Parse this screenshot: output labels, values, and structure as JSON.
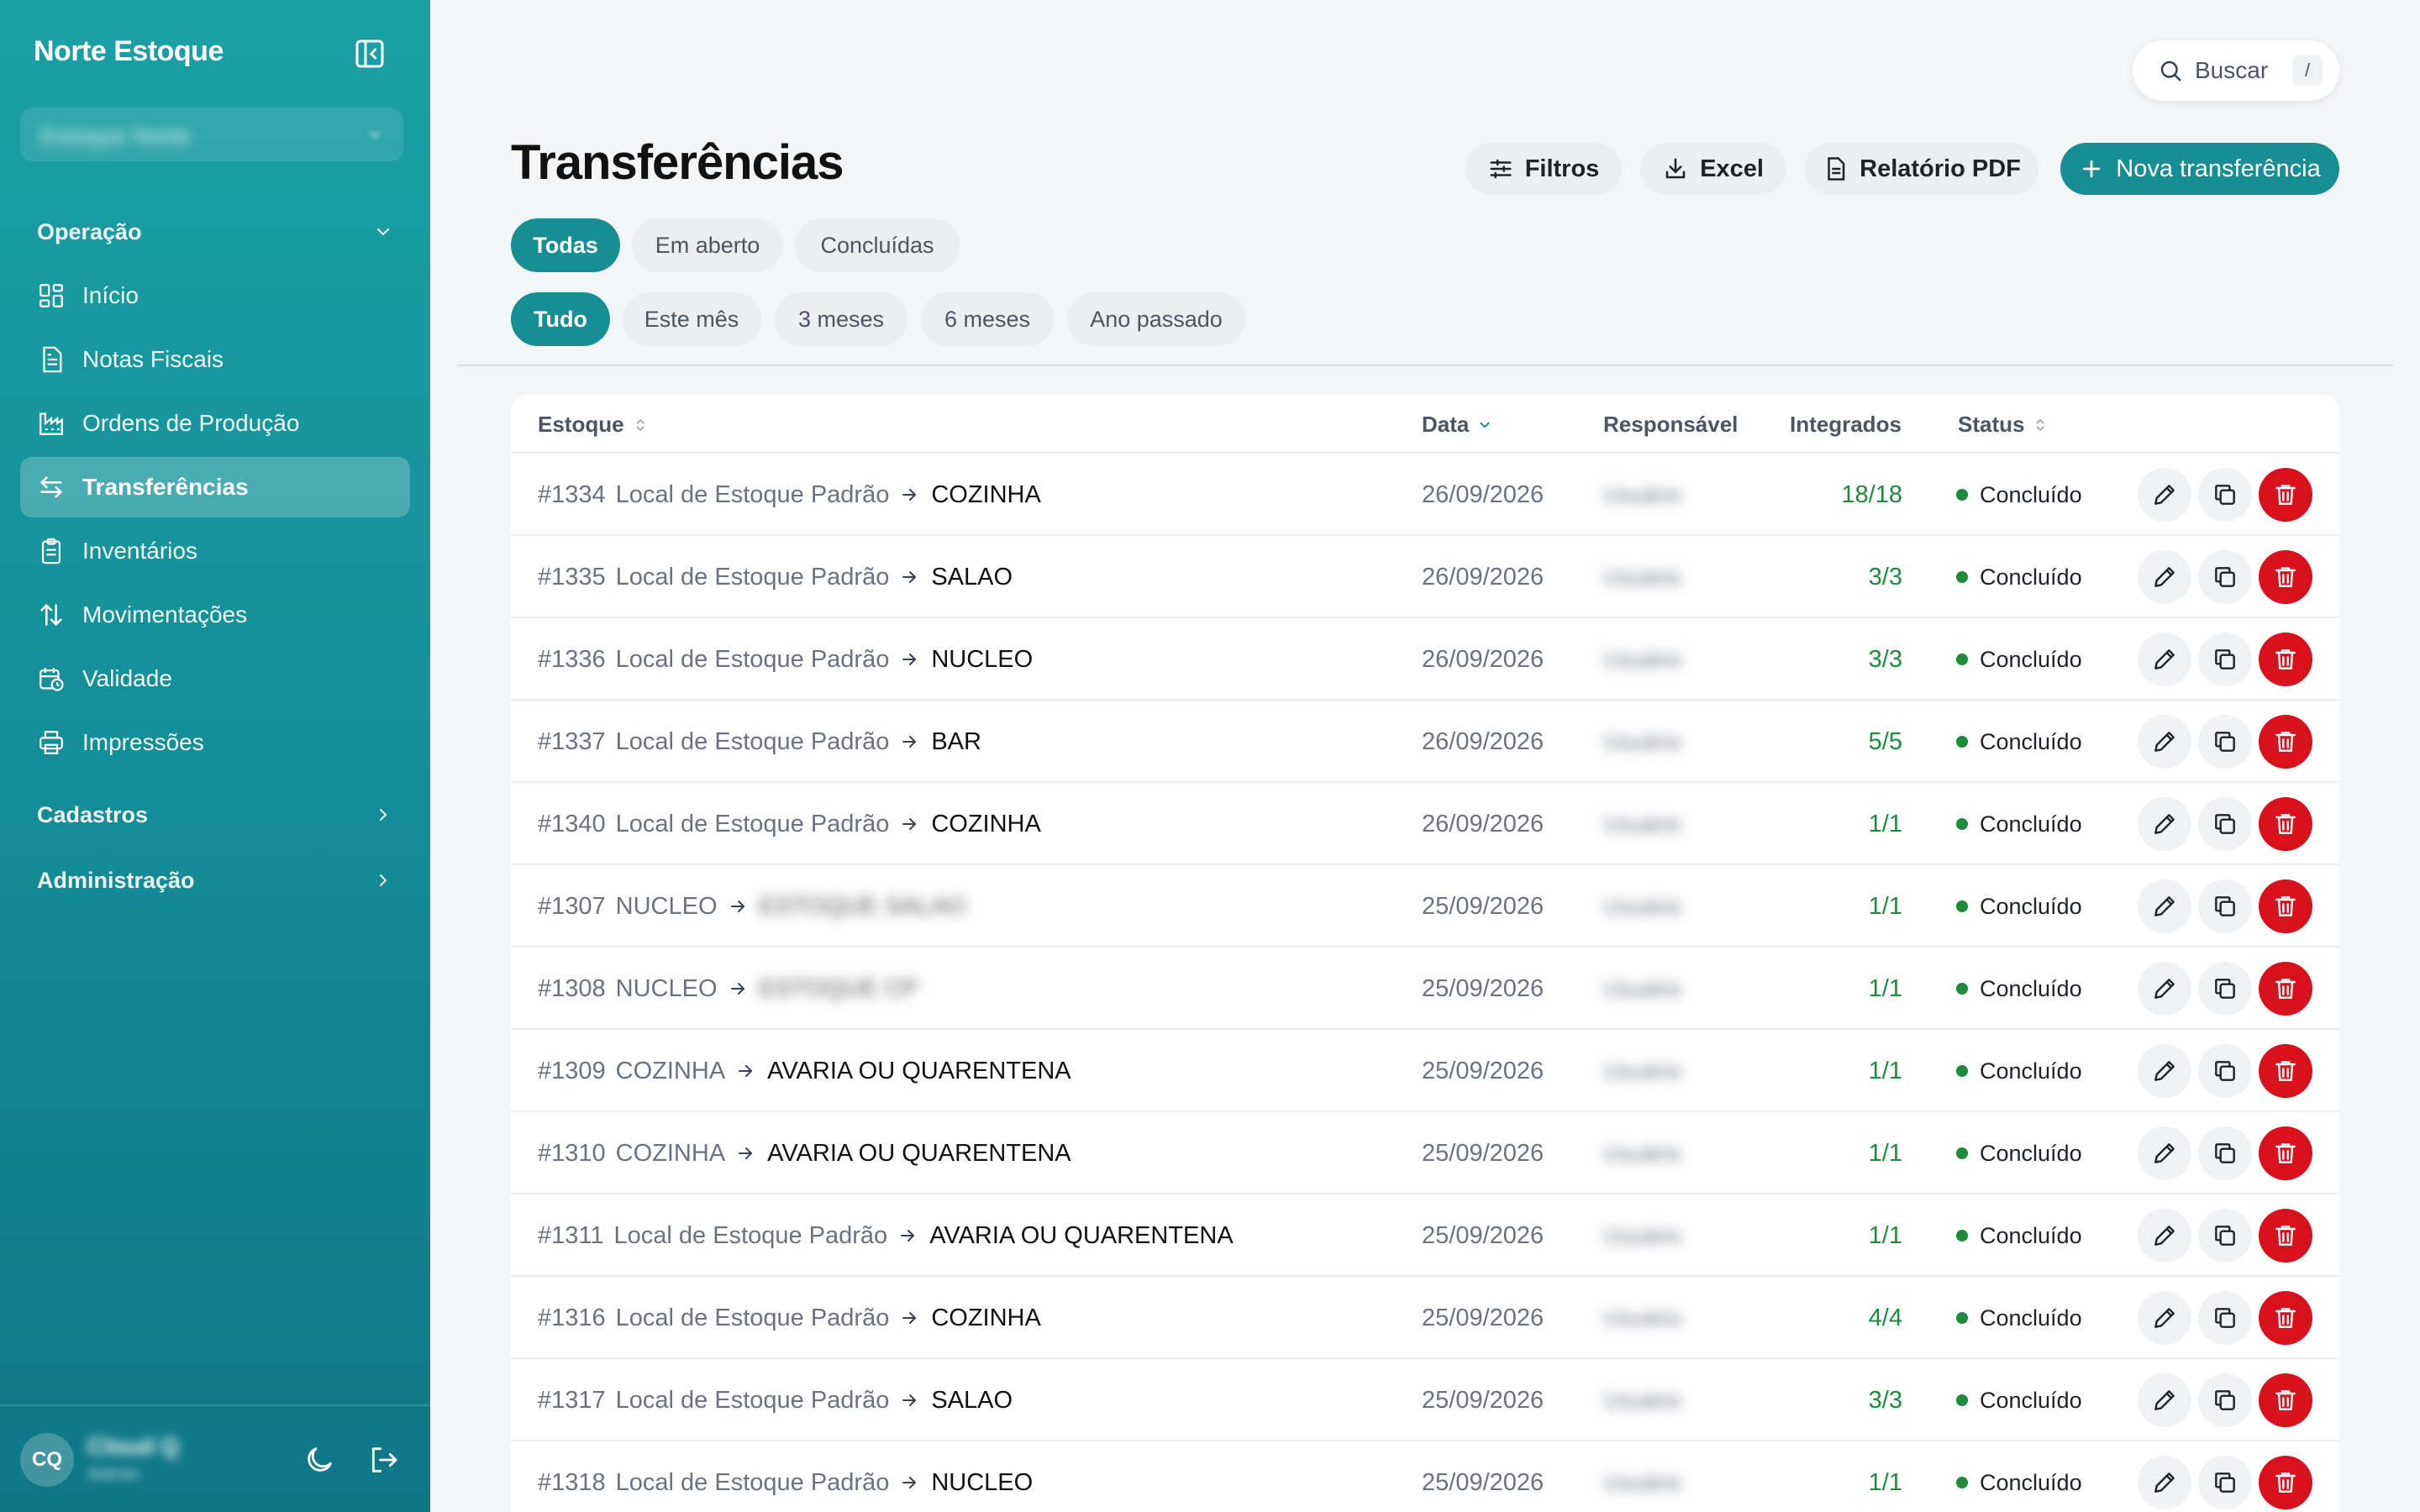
{
  "app": {
    "brand": "Norte Estoque",
    "org_selector": "Estoque Norte",
    "user_initials": "CQ",
    "user_name": "Cloud Q",
    "user_role": "Admin"
  },
  "sidebar": {
    "sections": [
      {
        "label": "Operação",
        "expanded": true
      },
      {
        "label": "Cadastros",
        "expanded": false
      },
      {
        "label": "Administração",
        "expanded": false
      }
    ],
    "items": [
      {
        "label": "Início",
        "icon": "dashboard-icon"
      },
      {
        "label": "Notas Fiscais",
        "icon": "document-icon"
      },
      {
        "label": "Ordens de Produção",
        "icon": "factory-icon"
      },
      {
        "label": "Transferências",
        "icon": "transfer-arrows-icon",
        "active": true
      },
      {
        "label": "Inventários",
        "icon": "clipboard-icon"
      },
      {
        "label": "Movimentações",
        "icon": "up-down-arrows-icon"
      },
      {
        "label": "Validade",
        "icon": "calendar-clock-icon"
      },
      {
        "label": "Impressões",
        "icon": "printer-icon"
      }
    ]
  },
  "header": {
    "search_placeholder": "Buscar",
    "search_shortcut": "/",
    "title": "Transferências",
    "buttons": {
      "filters": "Filtros",
      "excel": "Excel",
      "pdf": "Relatório PDF",
      "new": "Nova transferência"
    }
  },
  "status_tabs": [
    {
      "label": "Todas",
      "active": true
    },
    {
      "label": "Em aberto",
      "active": false
    },
    {
      "label": "Concluídas",
      "active": false
    }
  ],
  "period_tabs": [
    {
      "label": "Tudo",
      "active": true
    },
    {
      "label": "Este mês",
      "active": false
    },
    {
      "label": "3 meses",
      "active": false
    },
    {
      "label": "6 meses",
      "active": false
    },
    {
      "label": "Ano passado",
      "active": false
    }
  ],
  "table": {
    "columns": {
      "estoque": "Estoque",
      "data": "Data",
      "responsavel": "Responsável",
      "integrados": "Integrados",
      "status": "Status"
    },
    "rows": [
      {
        "id": "#1334",
        "origin": "Local de Estoque Padrão",
        "dest": "COZINHA",
        "date": "26/09/2026",
        "resp": "Usuário",
        "integrated": "18/18",
        "status": "Concluído"
      },
      {
        "id": "#1335",
        "origin": "Local de Estoque Padrão",
        "dest": "SALAO",
        "date": "26/09/2026",
        "resp": "Usuário",
        "integrated": "3/3",
        "status": "Concluído"
      },
      {
        "id": "#1336",
        "origin": "Local de Estoque Padrão",
        "dest": "NUCLEO",
        "date": "26/09/2026",
        "resp": "Usuário",
        "integrated": "3/3",
        "status": "Concluído"
      },
      {
        "id": "#1337",
        "origin": "Local de Estoque Padrão",
        "dest": "BAR",
        "date": "26/09/2026",
        "resp": "Usuário",
        "integrated": "5/5",
        "status": "Concluído"
      },
      {
        "id": "#1340",
        "origin": "Local de Estoque Padrão",
        "dest": "COZINHA",
        "date": "26/09/2026",
        "resp": "Usuário",
        "integrated": "1/1",
        "status": "Concluído"
      },
      {
        "id": "#1307",
        "origin": "NUCLEO",
        "dest": "ESTOQUE SALAO",
        "dest_blurred": true,
        "date": "25/09/2026",
        "resp": "Usuário",
        "integrated": "1/1",
        "status": "Concluído"
      },
      {
        "id": "#1308",
        "origin": "NUCLEO",
        "dest": "ESTOQUE CP",
        "dest_blurred": true,
        "date": "25/09/2026",
        "resp": "Usuário",
        "integrated": "1/1",
        "status": "Concluído"
      },
      {
        "id": "#1309",
        "origin": "COZINHA",
        "dest": "AVARIA OU QUARENTENA",
        "date": "25/09/2026",
        "resp": "Usuário",
        "integrated": "1/1",
        "status": "Concluído"
      },
      {
        "id": "#1310",
        "origin": "COZINHA",
        "dest": "AVARIA OU QUARENTENA",
        "date": "25/09/2026",
        "resp": "Usuário",
        "integrated": "1/1",
        "status": "Concluído"
      },
      {
        "id": "#1311",
        "origin": "Local de Estoque Padrão",
        "dest": "AVARIA OU QUARENTENA",
        "date": "25/09/2026",
        "resp": "Usuário",
        "integrated": "1/1",
        "status": "Concluído"
      },
      {
        "id": "#1316",
        "origin": "Local de Estoque Padrão",
        "dest": "COZINHA",
        "date": "25/09/2026",
        "resp": "Usuário",
        "integrated": "4/4",
        "status": "Concluído"
      },
      {
        "id": "#1317",
        "origin": "Local de Estoque Padrão",
        "dest": "SALAO",
        "date": "25/09/2026",
        "resp": "Usuário",
        "integrated": "3/3",
        "status": "Concluído"
      },
      {
        "id": "#1318",
        "origin": "Local de Estoque Padrão",
        "dest": "NUCLEO",
        "date": "25/09/2026",
        "resp": "Usuário",
        "integrated": "1/1",
        "status": "Concluído"
      }
    ]
  },
  "colors": {
    "sidebar_top": "#1aa0a5",
    "sidebar_bottom": "#0f7686",
    "accent": "#178e94",
    "success": "#1e8a3c",
    "danger": "#d8111d"
  }
}
